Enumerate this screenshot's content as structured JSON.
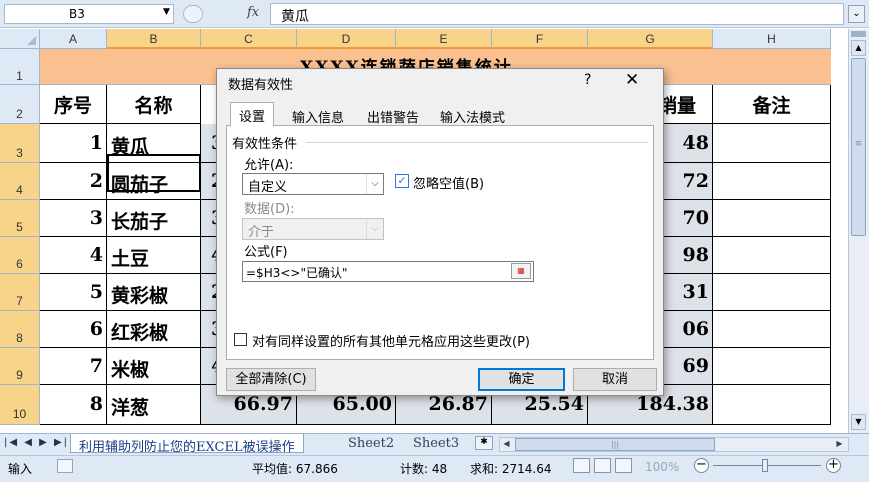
{
  "formula_bar": {
    "name_box": "B3",
    "fx_label": "fx",
    "formula_text": "黄瓜",
    "expand_icon": "chevron-down-icon"
  },
  "columns": [
    "A",
    "B",
    "C",
    "D",
    "E",
    "F",
    "G",
    "H"
  ],
  "rows": [
    "1",
    "2",
    "3",
    "4",
    "5",
    "6",
    "7",
    "8",
    "9",
    "10"
  ],
  "sheet_title": "XXXX连锁蔬店销售统计",
  "headers": {
    "a": "序号",
    "b": "名称",
    "g": "销量",
    "h": "备注"
  },
  "table_rows": [
    {
      "no": "1",
      "name": "黄瓜",
      "c": "3",
      "g": "48"
    },
    {
      "no": "2",
      "name": "圆茄子",
      "c": "2",
      "g": "72"
    },
    {
      "no": "3",
      "name": "长茄子",
      "c": "3",
      "g": "70"
    },
    {
      "no": "4",
      "name": "土豆",
      "c": "4",
      "g": "98"
    },
    {
      "no": "5",
      "name": "黄彩椒",
      "c": "2",
      "g": "31"
    },
    {
      "no": "6",
      "name": "红彩椒",
      "c": "3",
      "g": "06"
    },
    {
      "no": "7",
      "name": "米椒",
      "c": "4",
      "g": "69"
    },
    {
      "no": "8",
      "name": "洋葱",
      "c": "66.97",
      "d": "65.00",
      "e": "26.87",
      "f": "25.54",
      "g": "184.38"
    }
  ],
  "sheet_tabs": [
    "利用辅助列防止您的EXCEL被误操作",
    "Sheet2",
    "Sheet3"
  ],
  "status_bar": {
    "mode": "输入",
    "average": "平均值: 67.866",
    "count": "计数: 48",
    "sum": "求和: 2714.64",
    "zoom": "100%",
    "zoom_level_percent": 100
  },
  "dialog": {
    "title": "数据有效性",
    "help": "?",
    "close": "✕",
    "tabs": [
      "设置",
      "输入信息",
      "出错警告",
      "输入法模式"
    ],
    "active_tab": "设置",
    "group_label": "有效性条件",
    "allow_label": "允许(A):",
    "allow_value": "自定义",
    "ignore_blank_label": "忽略空值(B)",
    "ignore_blank_checked": true,
    "data_label": "数据(D):",
    "data_value": "介于",
    "formula_label": "公式(F)",
    "formula_value": "=$H3<>\"已确认\"",
    "apply_all_label": "对有同样设置的所有其他单元格应用这些更改(P)",
    "clear_all": "全部清除(C)",
    "ok": "确定",
    "cancel": "取消"
  },
  "colors": {
    "title_band": "#fac090",
    "selected_header": "#f7d48a",
    "accent": "#0078d7"
  }
}
